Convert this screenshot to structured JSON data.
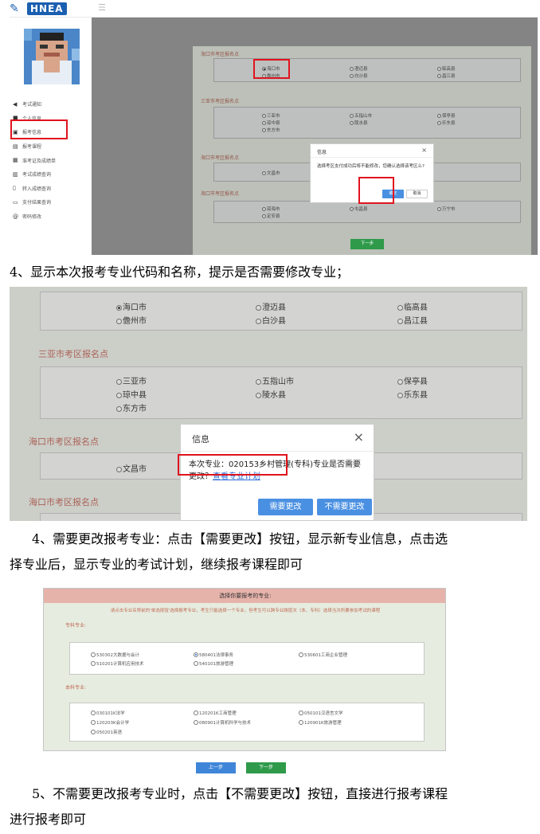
{
  "shot1": {
    "logo_text": "HNEA",
    "nav": [
      "考试通知",
      "个人信息",
      "报考信息",
      "报考课程",
      "准考证及成绩单",
      "考试成绩查询",
      "转入成绩查询",
      "支付结果查询",
      "密码修改"
    ],
    "sections": [
      {
        "title": "海口市考区报名点",
        "options": [
          "海口市",
          "儋州市",
          "澄迈县",
          "白沙县",
          "临高县",
          "昌江县"
        ]
      },
      {
        "title": "三亚市考区报名点",
        "options": [
          "三亚市",
          "琼中县",
          "东方市",
          "五指山市",
          "陵水县",
          "保亭县",
          "乐东县"
        ]
      },
      {
        "title": "海口市考区报名点",
        "options": [
          "文昌市"
        ]
      },
      {
        "title": "海口市考区报名点",
        "options": [
          "琼海市",
          "定安县",
          "屯昌县",
          "万宁市"
        ]
      }
    ],
    "dialog": {
      "title": "信息",
      "close": "×",
      "message": "选择考区支付成功后将不能修改，您确认选择该考区么?",
      "ok": "确定",
      "cancel": "取消"
    },
    "next": "下一步"
  },
  "step4a": "4、显示本次报考专业代码和名称，提示是否需要修改专业；",
  "shot2": {
    "row1": [
      "海口市",
      "澄迈县",
      "临高县"
    ],
    "row2": [
      "儋州市",
      "白沙县",
      "昌江县"
    ],
    "section2": "三亚市考区报名点",
    "row3": [
      "三亚市",
      "五指山市",
      "保亭县"
    ],
    "row4": [
      "琼中县",
      "陵水县",
      "乐东县"
    ],
    "row5": [
      "东方市"
    ],
    "section3": "海口市考区报名点",
    "row6": [
      "文昌市"
    ],
    "section4": "海口市考区报名点",
    "dialog": {
      "title": "信息",
      "close": "×",
      "msg_main": "本次专业：020153乡村管理(专科)专业是否需要更改？",
      "link": "查看专业计划",
      "btn_change": "需要更改",
      "btn_nochange": "不需要更改"
    }
  },
  "step4b_line1": "4、需要更改报考专业：点击【需要更改】按钮，显示新专业信息，点击选",
  "step4b_line2": "择专业后，显示专业的考试计划，继续报考课程即可",
  "shot3": {
    "header": "选择你要报考的专业:",
    "note": "请点击专业名称前的'单选按钮'选择报考专业，考生只能选择一个专业，但考生可以跨专业跨层次（本、专科）选择当次所要参加考试的课程",
    "label_zk": "专科专业:",
    "zk": [
      "530302大数据与会计",
      "510201计算机应用技术",
      "580401法律事务",
      "540101旅游管理",
      "530601工商企业管理"
    ],
    "label_bk": "本科专业:",
    "bk": [
      "030101K法学",
      "120203K会计学",
      "050201英语",
      "120201K工商管理",
      "080901计算机科学与技术",
      "050101汉语言文学",
      "120901K旅游管理"
    ],
    "prev": "上一步",
    "next": "下一步"
  },
  "step5_line1": "5、不需要更改报考专业时，点击【不需要更改】按钮，直接进行报考课程",
  "step5_line2": "进行报考即可",
  "colors": {
    "red_box": "#e0141e",
    "blue_button": "#4a90e2",
    "green_button": "#2e9a4a",
    "section_text": "#c16a5c"
  }
}
